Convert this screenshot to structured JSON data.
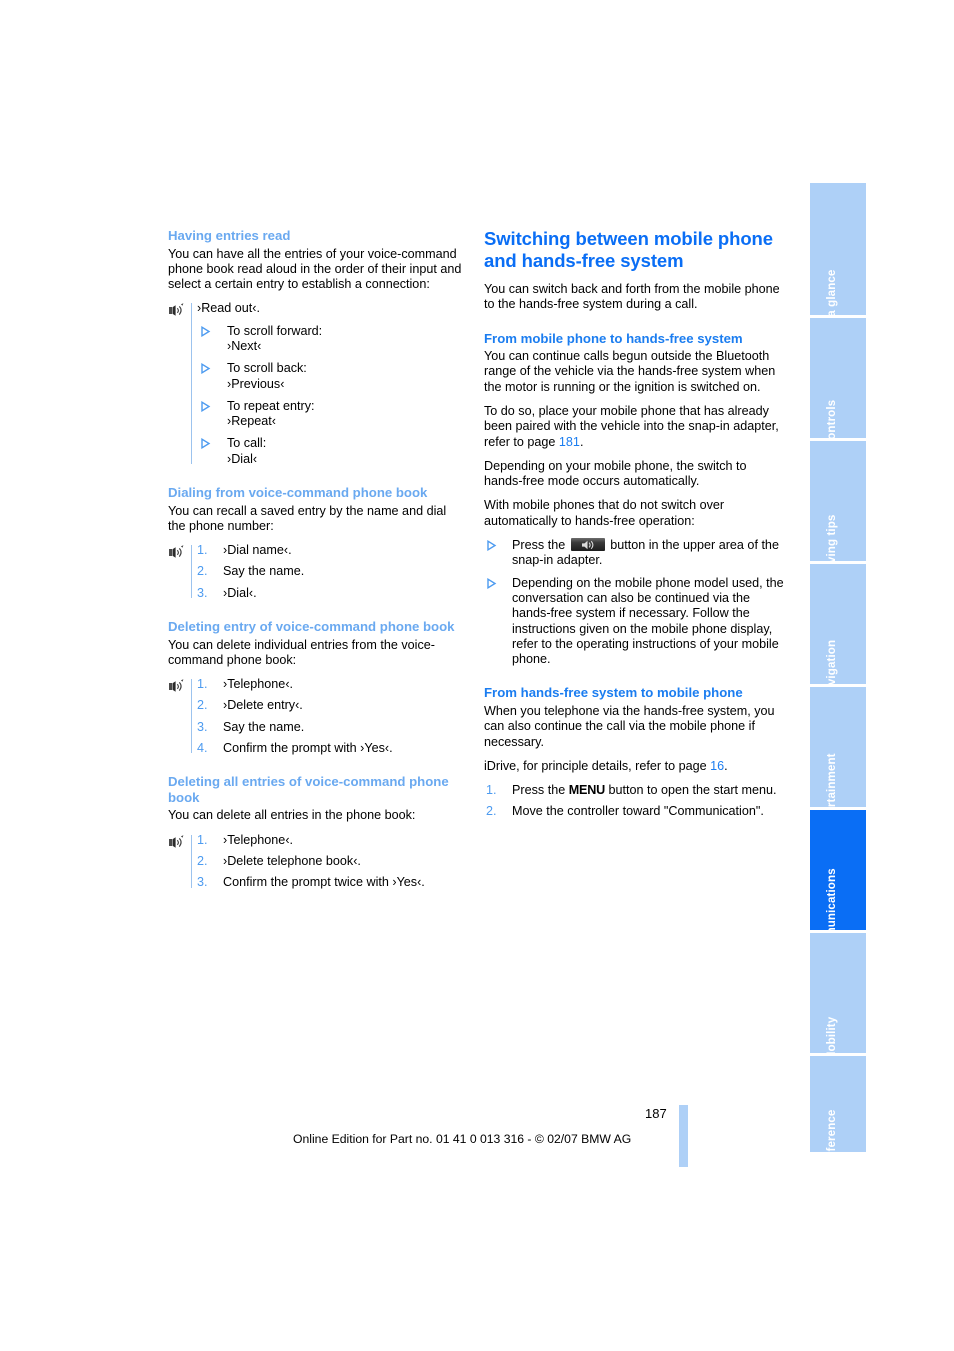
{
  "document": {
    "page_number": "187",
    "footer_text": "Online Edition for Part no. 01 41 0 013 316 - © 02/07 BMW AG"
  },
  "sidebar": {
    "tabs": [
      {
        "label": "At a glance",
        "active": false
      },
      {
        "label": "Controls",
        "active": false
      },
      {
        "label": "Driving tips",
        "active": false
      },
      {
        "label": "Navigation",
        "active": false
      },
      {
        "label": "Entertainment",
        "active": false
      },
      {
        "label": "Communications",
        "active": true
      },
      {
        "label": "Mobility",
        "active": false
      },
      {
        "label": "Reference",
        "active": false
      }
    ]
  },
  "left_column": {
    "section1": {
      "heading": "Having entries read",
      "intro": "You can have all the entries of your voice-command phone book read aloud in the order of their input and select a certain entry to establish a connection:",
      "first_command": "›Read out‹.",
      "items": [
        {
          "label": "To scroll forward:",
          "command": "›Next‹"
        },
        {
          "label": "To scroll back:",
          "command": "›Previous‹"
        },
        {
          "label": "To repeat entry:",
          "command": "›Repeat‹"
        },
        {
          "label": "To call:",
          "command": "›Dial‹"
        }
      ]
    },
    "section2": {
      "heading": "Dialing from voice-command phone book",
      "intro": "You can recall a saved entry by the name and dial the phone number:",
      "steps": [
        {
          "num": "1.",
          "text": "›Dial name‹."
        },
        {
          "num": "2.",
          "text": "Say the name."
        },
        {
          "num": "3.",
          "text": "›Dial‹."
        }
      ]
    },
    "section3": {
      "heading": "Deleting entry of voice-command phone book",
      "intro": "You can delete individual entries from the voice-command phone book:",
      "steps": [
        {
          "num": "1.",
          "text": "›Telephone‹."
        },
        {
          "num": "2.",
          "text": "›Delete entry‹."
        },
        {
          "num": "3.",
          "text": "Say the name."
        },
        {
          "num": "4.",
          "text": "Confirm the prompt with ›Yes‹."
        }
      ]
    },
    "section4": {
      "heading": "Deleting all entries of voice-command phone book",
      "intro": "You can delete all entries in the phone book:",
      "steps": [
        {
          "num": "1.",
          "text": "›Telephone‹."
        },
        {
          "num": "2.",
          "text": "›Delete telephone book‹."
        },
        {
          "num": "3.",
          "text": "Confirm the prompt twice with ›Yes‹."
        }
      ]
    }
  },
  "right_column": {
    "main_heading": "Switching between mobile phone and hands-free system",
    "intro": "You can switch back and forth from the mobile phone to the hands-free system during a call.",
    "section1": {
      "heading": "From mobile phone to hands-free system",
      "para1": "You can continue calls begun outside the Bluetooth range of the vehicle via the hands-free system when the motor is running or the ignition is switched on.",
      "para2_pre": "To do so, place your mobile phone that has already been paired with the vehicle into the snap-in adapter, refer to page ",
      "para2_ref": "181",
      "para2_post": ".",
      "para3": "Depending on your mobile phone, the switch to hands-free mode occurs automatically.",
      "para4": "With mobile phones that do not switch over automatically to hands-free operation:",
      "bullet1_pre": "Press the ",
      "bullet1_post": " button in the upper area of the snap-in adapter.",
      "bullet2": "Depending on the mobile phone model used, the conversation can also be continued via the hands-free system if necessary. Follow the instructions given on the mobile phone display, refer to the operating instructions of your mobile phone."
    },
    "section2": {
      "heading": "From hands-free system to mobile phone",
      "para1": "When you telephone via the hands-free system, you can also continue the call via the mobile phone if necessary.",
      "para2_pre": "iDrive, for principle details, refer to page ",
      "para2_ref": "16",
      "para2_post": ".",
      "steps": [
        {
          "num": "1.",
          "pre": "Press the ",
          "key": "MENU",
          "post": " button to open the start menu."
        },
        {
          "num": "2.",
          "pre": "Move the controller toward \"Communication\".",
          "key": "",
          "post": ""
        }
      ]
    }
  },
  "colors": {
    "main_heading": "#0a6ef5",
    "sub_heading": "#6aa9f0",
    "tab_inactive": "#aed0f7",
    "tab_active": "#0a6ef5",
    "page_reference": "#1b7df0"
  }
}
